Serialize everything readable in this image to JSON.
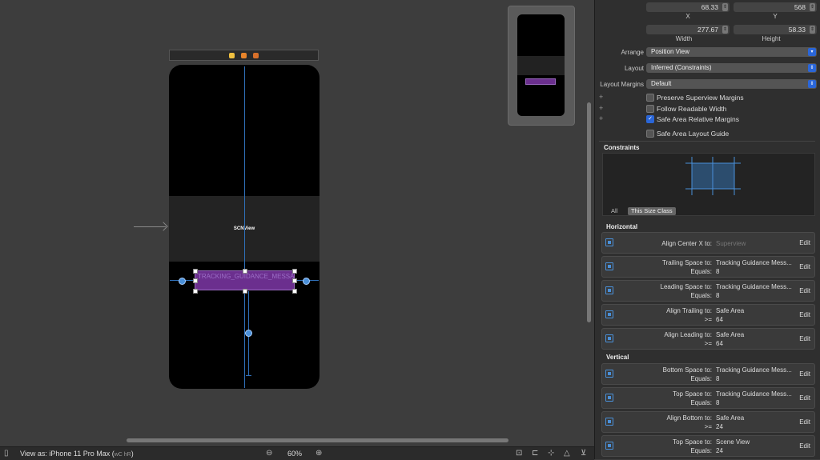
{
  "canvas": {
    "scn_view_label": "SCNView",
    "tracking_label_text": "TRACKING_GUIDANCE_MESSAG"
  },
  "bottom_bar": {
    "view_as": "View as: iPhone 11 Pro Max (",
    "traits": "wC hR",
    "close_paren": ")",
    "zoom": "60%"
  },
  "inspector": {
    "x_value": "68.33",
    "y_value": "568",
    "x_label": "X",
    "y_label": "Y",
    "width_value": "277.67",
    "height_value": "58.33",
    "width_label": "Width",
    "height_label": "Height",
    "arrange_label": "Arrange",
    "arrange_value": "Position View",
    "layout_label": "Layout",
    "layout_value": "Inferred (Constraints)",
    "margins_label": "Layout Margins",
    "margins_value": "Default",
    "checks": [
      {
        "label": "Preserve Superview Margins",
        "checked": false
      },
      {
        "label": "Follow Readable Width",
        "checked": false
      },
      {
        "label": "Safe Area Relative Margins",
        "checked": true
      },
      {
        "label": "Safe Area Layout Guide",
        "checked": false
      }
    ],
    "constraints_title": "Constraints",
    "seg_all": "All",
    "seg_size_class": "This Size Class",
    "horizontal_title": "Horizontal",
    "vertical_title": "Vertical",
    "edit_label": "Edit",
    "horizontal": [
      {
        "title": "Align Center X to:",
        "target": "Superview",
        "relation": "",
        "constant": ""
      },
      {
        "title": "Trailing Space to:",
        "target": "Tracking Guidance Mess...",
        "relation": "Equals:",
        "constant": "8"
      },
      {
        "title": "Leading Space to:",
        "target": "Tracking Guidance Mess...",
        "relation": "Equals:",
        "constant": "8"
      },
      {
        "title": "Align Trailing to:",
        "target": "Safe Area",
        "relation": ">=",
        "constant": "64"
      },
      {
        "title": "Align Leading to:",
        "target": "Safe Area",
        "relation": ">=",
        "constant": "64"
      }
    ],
    "vertical": [
      {
        "title": "Bottom Space to:",
        "target": "Tracking Guidance Mess...",
        "relation": "Equals:",
        "constant": "8"
      },
      {
        "title": "Top Space to:",
        "target": "Tracking Guidance Mess...",
        "relation": "Equals:",
        "constant": "8"
      },
      {
        "title": "Align Bottom to:",
        "target": "Safe Area",
        "relation": ">=",
        "constant": "24"
      },
      {
        "title": "Top Space to:",
        "target": "Scene View",
        "relation": "Equals:",
        "constant": "24"
      }
    ]
  }
}
